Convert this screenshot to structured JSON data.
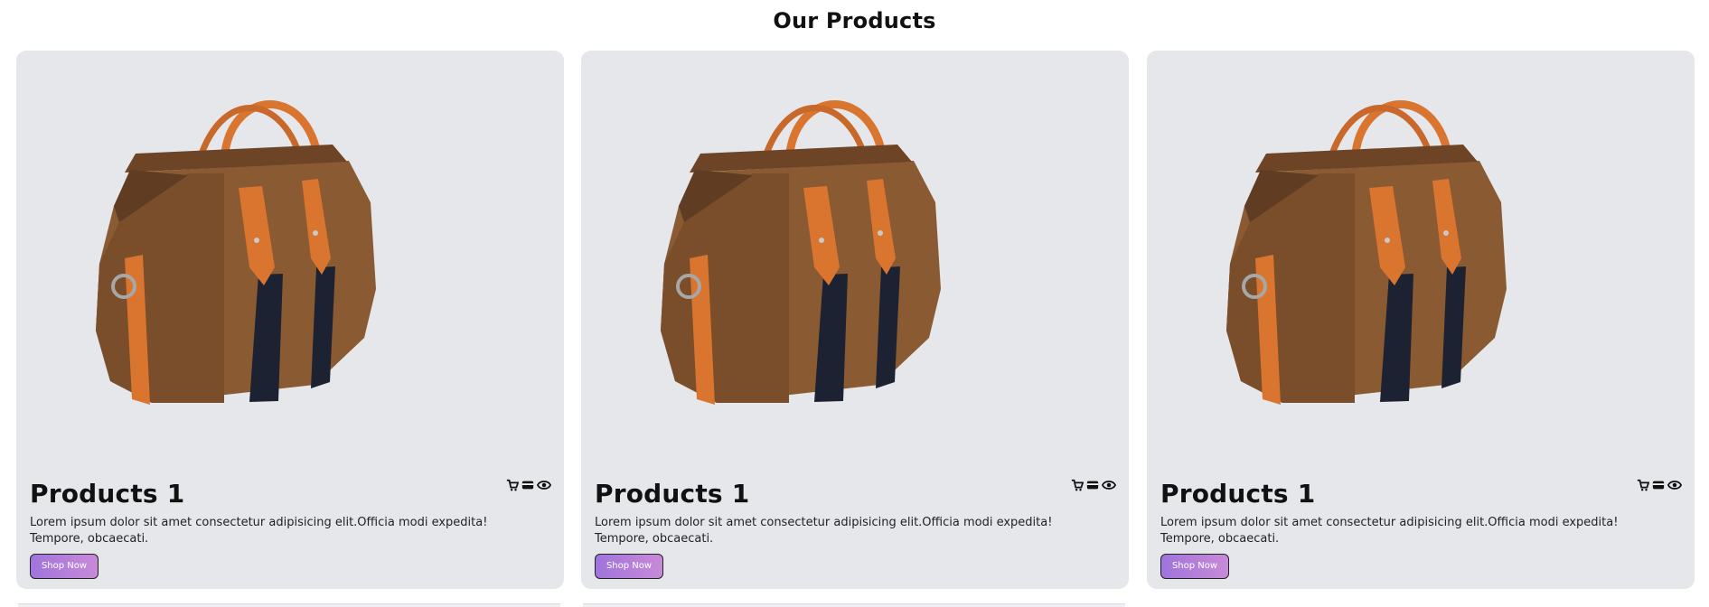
{
  "page": {
    "title": "Our Products"
  },
  "products": [
    {
      "title": "Products 1",
      "description": "Lorem ipsum dolor sit amet consectetur adipisicing elit.Officia modi expedita! Tempore, obcaecati.",
      "button_label": "Shop Now",
      "image": "brown-duffel-bag",
      "icons": [
        "cart-icon",
        "credit-card-icon",
        "eye-icon"
      ]
    },
    {
      "title": "Products 1",
      "description": "Lorem ipsum dolor sit amet consectetur adipisicing elit.Officia modi expedita! Tempore, obcaecati.",
      "button_label": "Shop Now",
      "image": "brown-duffel-bag",
      "icons": [
        "cart-icon",
        "credit-card-icon",
        "eye-icon"
      ]
    },
    {
      "title": "Products 1",
      "description": "Lorem ipsum dolor sit amet consectetur adipisicing elit.Officia modi expedita! Tempore, obcaecati.",
      "button_label": "Shop Now",
      "image": "brown-duffel-bag",
      "icons": [
        "cart-icon",
        "credit-card-icon",
        "eye-icon"
      ]
    }
  ],
  "colors": {
    "card_background": "#e5e7eb",
    "button_gradient_start": "#9f74dc",
    "button_gradient_end": "#c88ad8",
    "bag_brown": "#8a5a32",
    "strap_orange": "#d9752f",
    "stripe_navy": "#1d2233"
  }
}
